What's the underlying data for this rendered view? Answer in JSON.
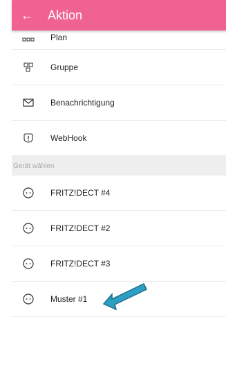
{
  "header": {
    "title": "Aktion",
    "back_icon": "back-arrow-icon"
  },
  "actions": [
    {
      "label": "Plan",
      "icon": "plan-icon"
    },
    {
      "label": "Gruppe",
      "icon": "group-icon"
    },
    {
      "label": "Benachrichtigung",
      "icon": "envelope-icon"
    },
    {
      "label": "WebHook",
      "icon": "webhook-icon"
    }
  ],
  "section_label": "Gerät wählen",
  "devices": [
    {
      "label": "FRITZ!DECT #4",
      "icon": "socket-icon"
    },
    {
      "label": "FRITZ!DECT #2",
      "icon": "socket-icon"
    },
    {
      "label": "FRITZ!DECT #3",
      "icon": "socket-icon"
    },
    {
      "label": "Muster #1",
      "icon": "socket-icon"
    }
  ],
  "colors": {
    "header": "#f06292",
    "arrow": "#2e9fc4"
  }
}
